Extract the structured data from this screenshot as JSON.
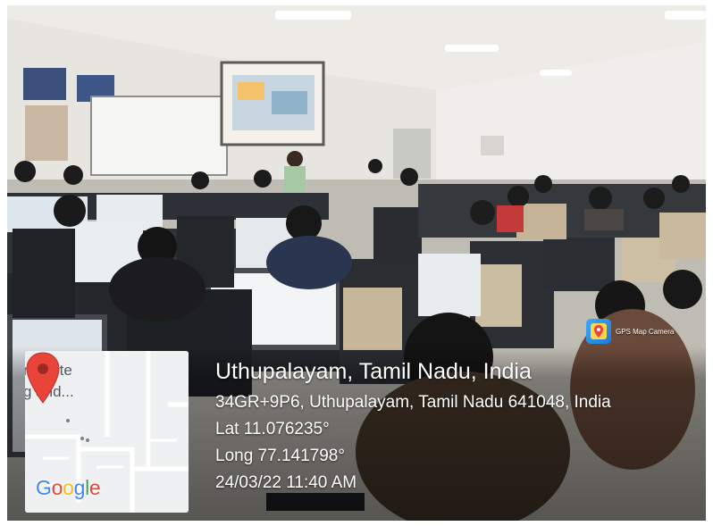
{
  "photo": {
    "description_icon": "classroom-photo"
  },
  "map_thumbnail": {
    "label_line_1": "nstitute",
    "label_line_2": "g and...",
    "brand": "Google",
    "pin_icon": "map-pin-icon",
    "colors": {
      "pin": "#e8443a",
      "g_blue": "#4285F4",
      "g_red": "#EA4335",
      "g_yellow": "#FBBC05",
      "g_green": "#34A853"
    }
  },
  "geotag": {
    "title": "Uthupalayam, Tamil Nadu, India",
    "address": "34GR+9P6, Uthupalayam, Tamil Nadu 641048, India",
    "latitude": "Lat 11.076235°",
    "longitude": "Long 77.141798°",
    "datetime": "24/03/22 11:40 AM"
  },
  "watermark": {
    "app_name": "GPS Map Camera",
    "icon": "gps-map-camera-icon"
  }
}
